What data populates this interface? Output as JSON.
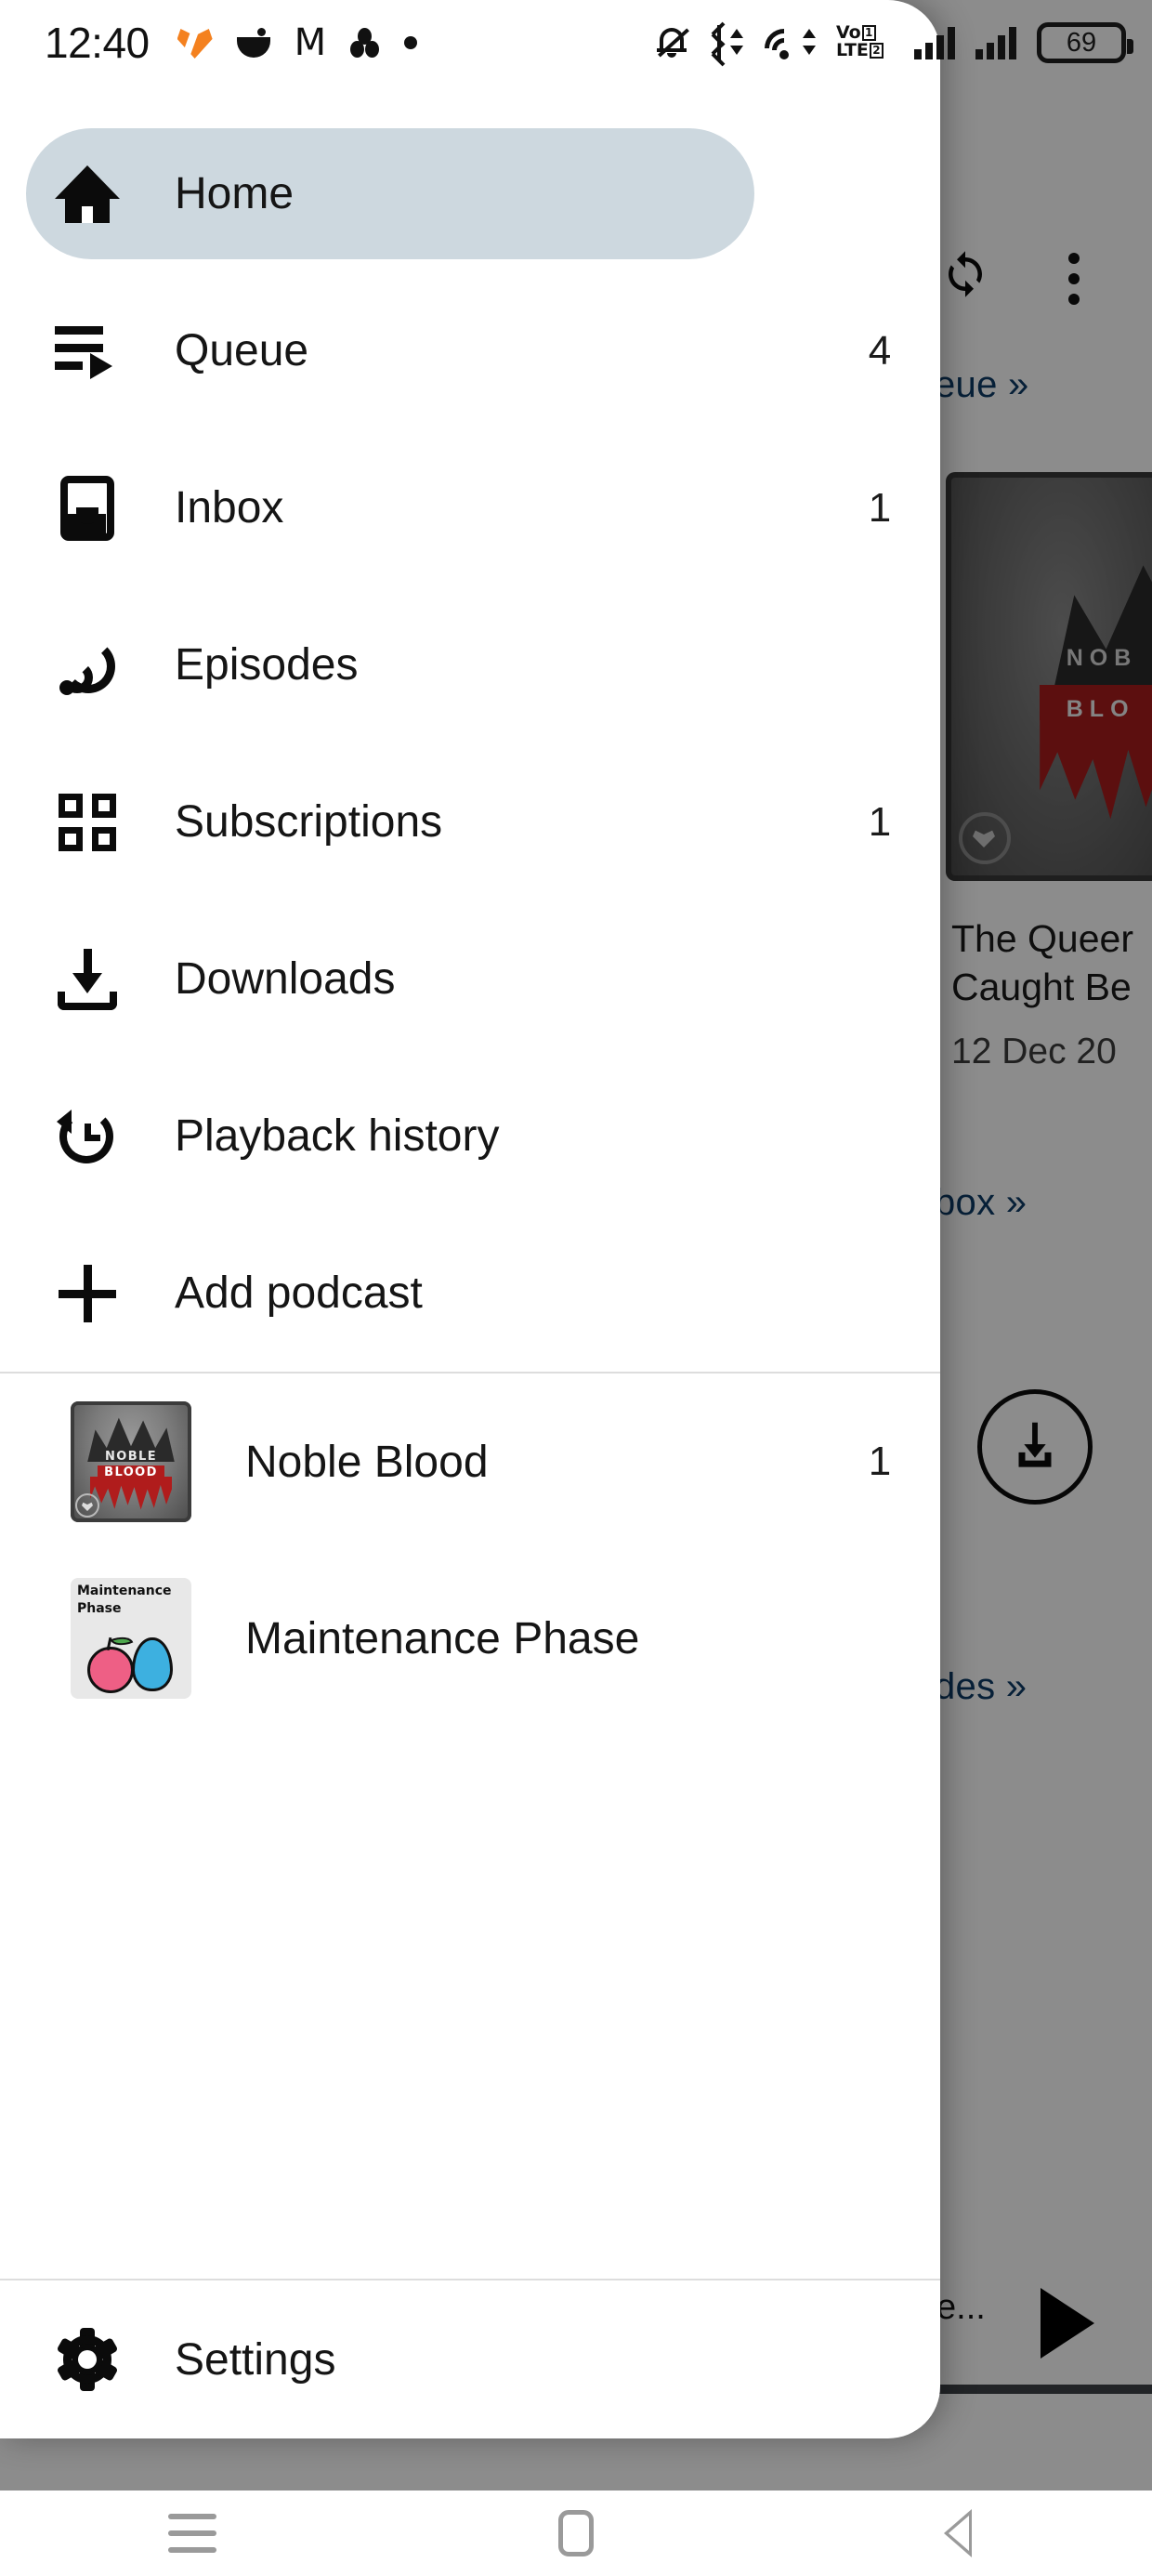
{
  "status_bar": {
    "time": "12:40",
    "battery_percent": "69",
    "left_icons": [
      "heart-orange-icon",
      "cooking-pot-icon",
      "gmail-icon",
      "three-dots-cluster-icon",
      "single-dot-icon"
    ],
    "right_icons": [
      "bell-muted-icon",
      "bluetooth-icon",
      "wifi-icon",
      "volte-icon",
      "signal-sim1-icon",
      "signal-sim2-icon",
      "battery-icon"
    ]
  },
  "drawer": {
    "nav_items": [
      {
        "label": "Home",
        "count": "",
        "icon": "home-icon",
        "active": true
      },
      {
        "label": "Queue",
        "count": "4",
        "icon": "queue-icon",
        "active": false
      },
      {
        "label": "Inbox",
        "count": "1",
        "icon": "inbox-icon",
        "active": false
      },
      {
        "label": "Episodes",
        "count": "",
        "icon": "rss-icon",
        "active": false
      },
      {
        "label": "Subscriptions",
        "count": "1",
        "icon": "grid-icon",
        "active": false
      },
      {
        "label": "Downloads",
        "count": "",
        "icon": "download-icon",
        "active": false
      },
      {
        "label": "Playback history",
        "count": "",
        "icon": "history-icon",
        "active": false
      },
      {
        "label": "Add podcast",
        "count": "",
        "icon": "plus-icon",
        "active": false
      }
    ],
    "podcasts": [
      {
        "label": "Noble Blood",
        "count": "1",
        "artwork": "noble-blood-cover"
      },
      {
        "label": "Maintenance Phase",
        "count": "",
        "artwork": "maintenance-phase-cover"
      }
    ],
    "settings": {
      "label": "Settings",
      "icon": "gear-icon"
    },
    "active_highlight_color": "#cdd8df"
  },
  "background_screen": {
    "appbar_icons": [
      "refresh-icon",
      "overflow-menu-icon"
    ],
    "section_links": [
      {
        "text": "eue »",
        "full": "Queue »"
      },
      {
        "text": "box »",
        "full": "Inbox »"
      },
      {
        "text": "des »",
        "full": "Episodes »"
      }
    ],
    "episode_card": {
      "artwork": "noble-blood-cover",
      "artwork_text_line1": "NOB",
      "artwork_text_line2": "BLO",
      "title": "The Queer Caught Be",
      "date": "12 Dec 20"
    },
    "download_button_icon": "download-circle-icon",
    "player": {
      "title": "e...",
      "play_icon": "play-icon"
    },
    "link_color": "#0d3b66",
    "scrim_color": "rgba(0,0,0,0.45)"
  },
  "system_nav": {
    "buttons": [
      {
        "name": "recents",
        "icon": "recents-icon"
      },
      {
        "name": "home",
        "icon": "home-square-icon"
      },
      {
        "name": "back",
        "icon": "back-triangle-icon"
      }
    ]
  }
}
